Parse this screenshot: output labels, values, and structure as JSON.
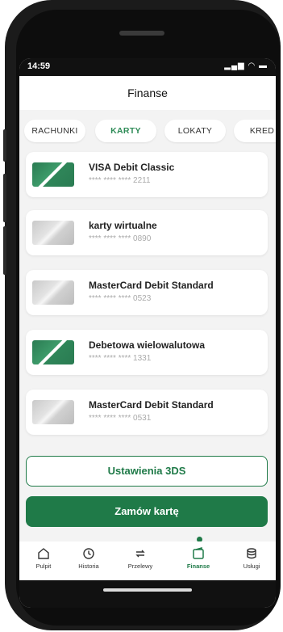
{
  "status_bar": {
    "time": "14:59",
    "icons": "▂▄▆ ◠ ▬"
  },
  "header": {
    "title": "Finanse"
  },
  "tabs": [
    {
      "label": "RACHUNKI"
    },
    {
      "label": "KARTY"
    },
    {
      "label": "LOKATY"
    },
    {
      "label": "KRED"
    }
  ],
  "active_tab": "KARTY",
  "cards": [
    {
      "name": "VISA Debit Classic",
      "number": "**** **** **** 2211",
      "thumb": "green-card"
    },
    {
      "name": "karty wirtualne",
      "number": "**** **** **** 0890",
      "thumb": "gray-card"
    },
    {
      "name": "MasterCard Debit Standard",
      "number": "**** **** **** 0523",
      "thumb": "gray-card"
    },
    {
      "name": "Debetowa wielowalutowa",
      "number": "**** **** **** 1331",
      "thumb": "green-card"
    },
    {
      "name": "MasterCard Debit Standard",
      "number": "**** **** **** 0531",
      "thumb": "gray-card"
    }
  ],
  "buttons": {
    "settings_3ds": "Ustawienia 3DS",
    "order_card": "Zamów kartę"
  },
  "bottom_nav": [
    {
      "label": "Pulpit",
      "icon": "home-icon"
    },
    {
      "label": "Historia",
      "icon": "history-icon"
    },
    {
      "label": "Przelewy",
      "icon": "transfer-icon"
    },
    {
      "label": "Finanse",
      "icon": "finance-icon"
    },
    {
      "label": "Usługi",
      "icon": "services-icon"
    }
  ],
  "active_nav": "Finanse",
  "colors": {
    "accent": "#1f7a48",
    "background": "#f3f3f3",
    "card_bg": "#ffffff"
  }
}
